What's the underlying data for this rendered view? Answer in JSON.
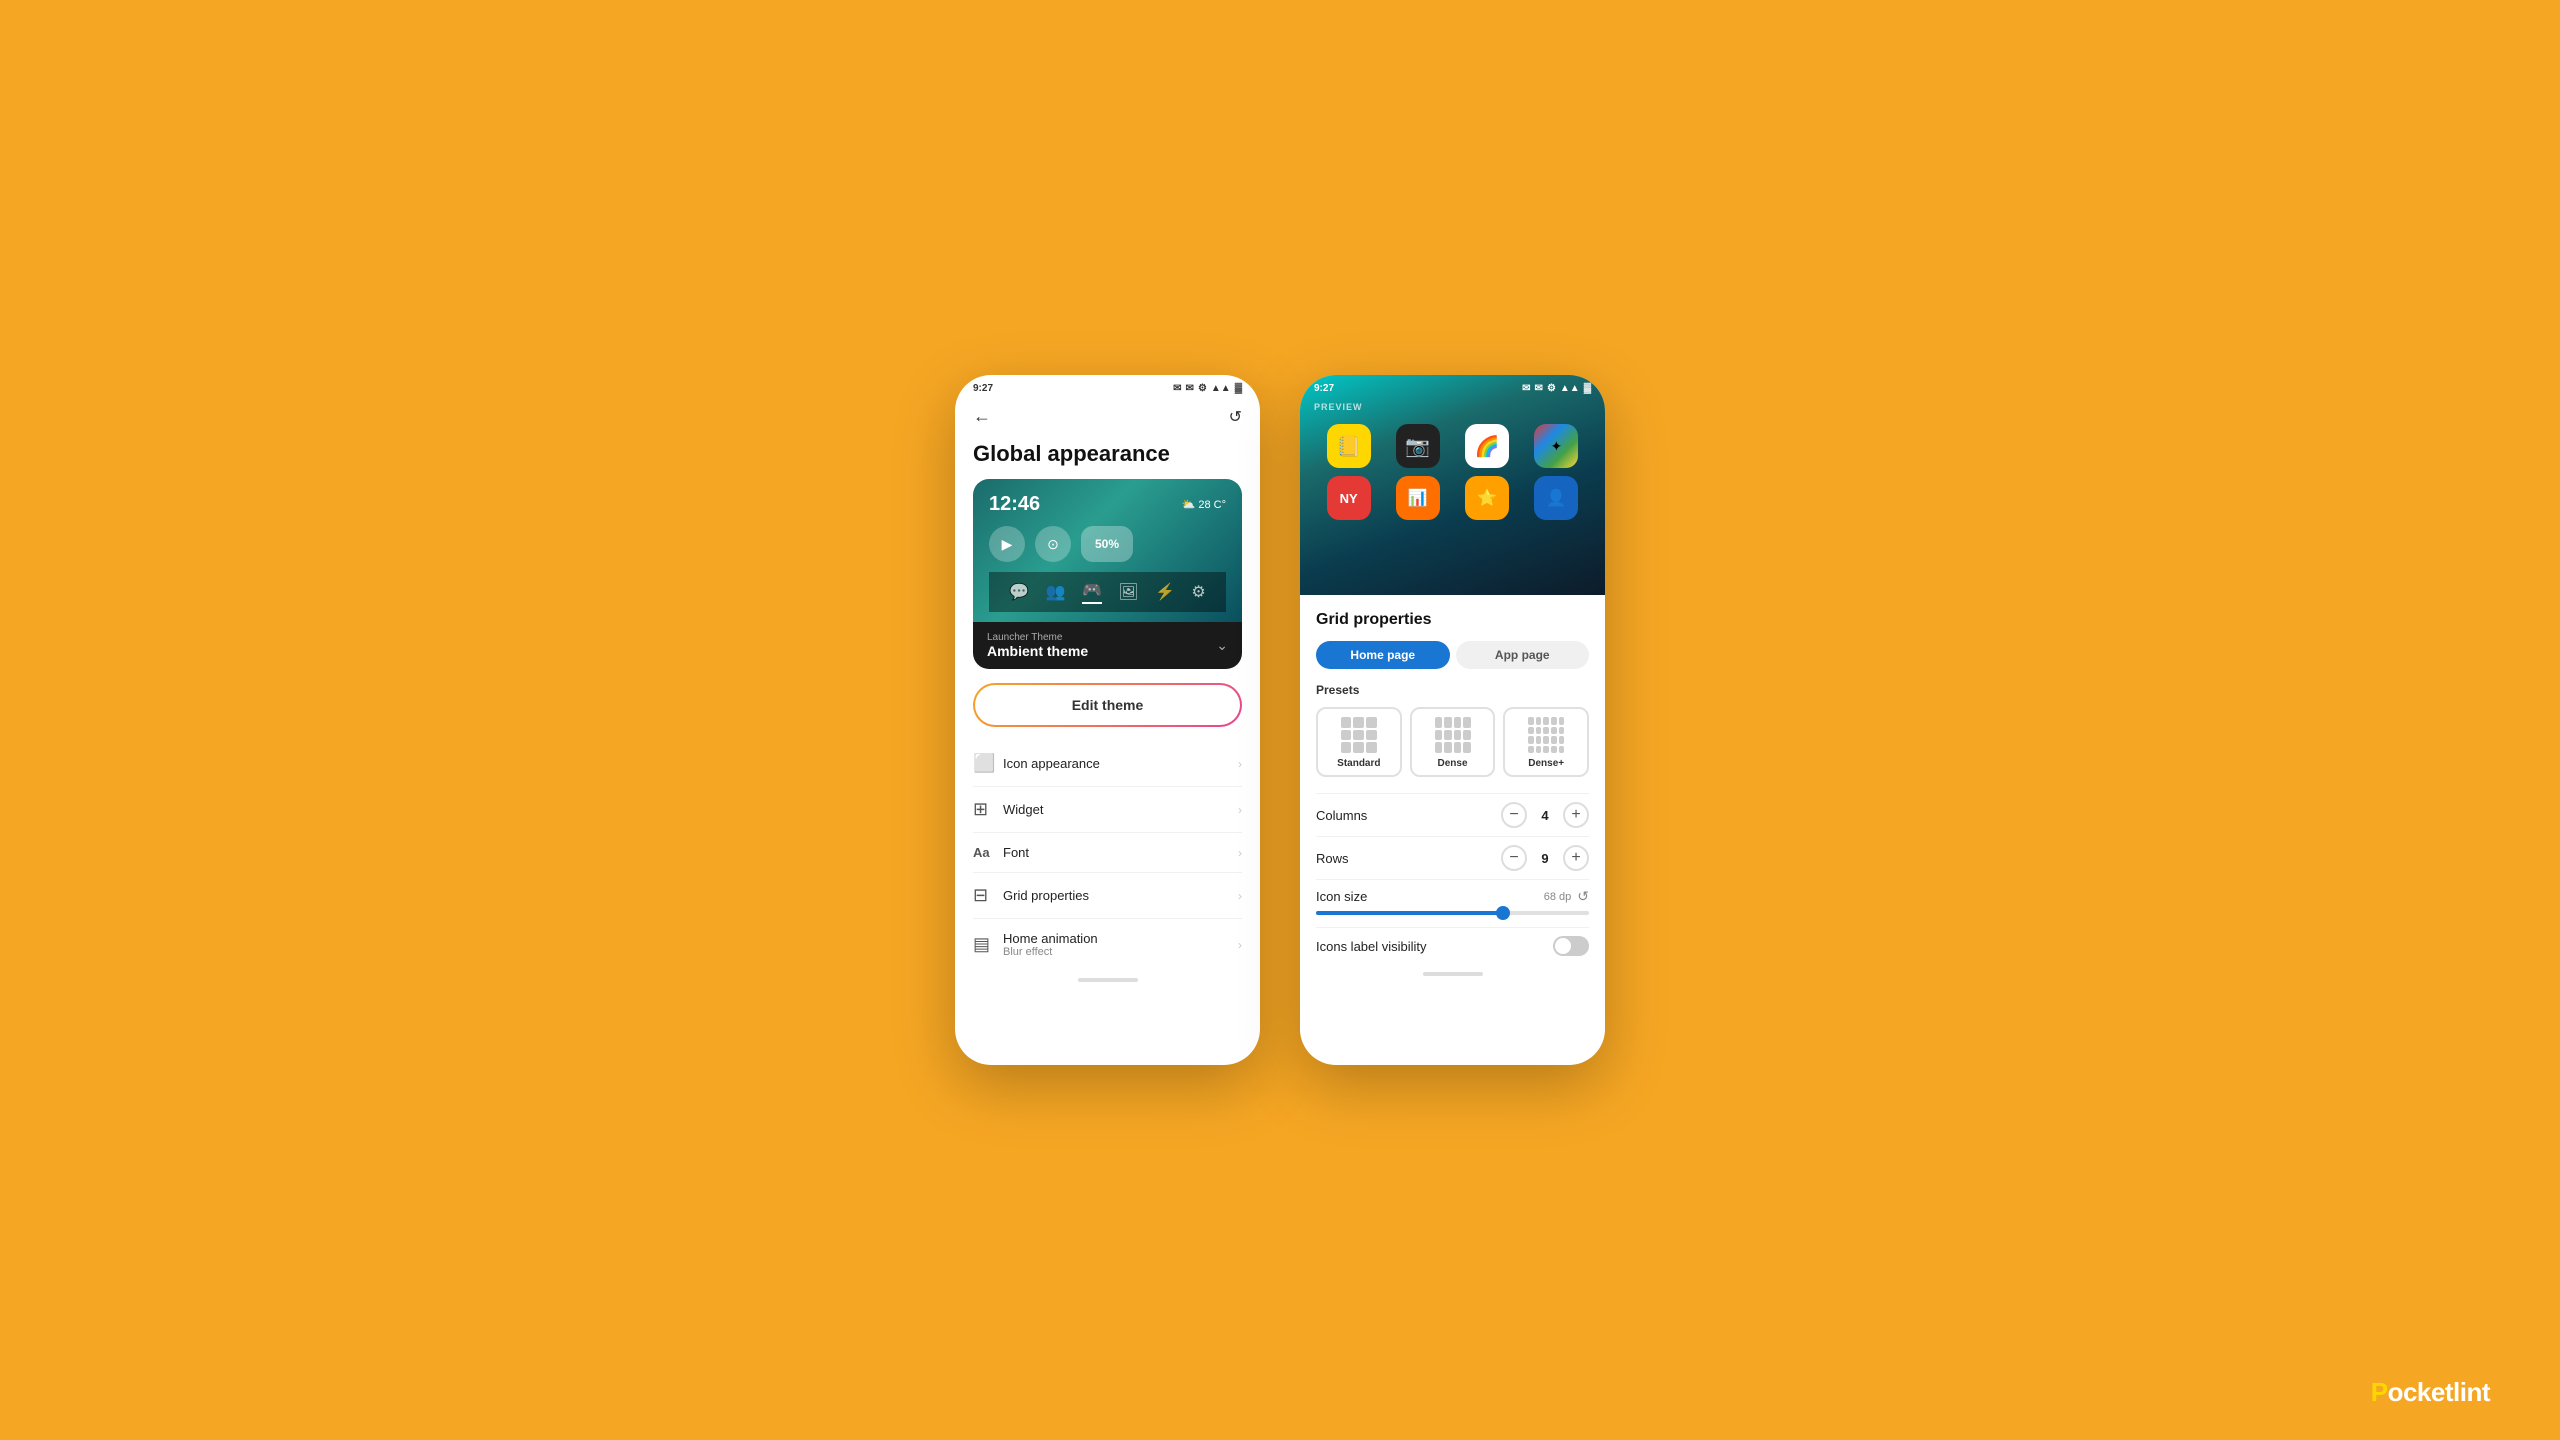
{
  "background": "#F5A623",
  "phone1": {
    "statusBar": {
      "time": "9:27",
      "icons": [
        "✉",
        "✉",
        "⚙",
        "●"
      ]
    },
    "topBar": {
      "backLabel": "←",
      "refreshLabel": "↺"
    },
    "pageTitle": "Global appearance",
    "themePreview": {
      "time": "12:46",
      "weather": "⛅ 28 C°",
      "app1": "▶",
      "app2": "⊙",
      "batteryText": "50%",
      "bottomIcons": [
        "💬",
        "👥",
        "🎮",
        "🖼",
        "🔀",
        "⚙"
      ]
    },
    "launcherSelector": {
      "label": "Launcher Theme",
      "value": "Ambient theme",
      "chevron": "⌄"
    },
    "editThemeButton": "Edit theme",
    "menuItems": [
      {
        "icon": "⬜",
        "label": "Icon appearance",
        "sublabel": "",
        "hasChevron": true
      },
      {
        "icon": "⊞",
        "label": "Widget",
        "sublabel": "",
        "hasChevron": true
      },
      {
        "icon": "Aa",
        "label": "Font",
        "sublabel": "",
        "hasChevron": true
      },
      {
        "icon": "⊟",
        "label": "Grid properties",
        "sublabel": "",
        "hasChevron": true
      },
      {
        "icon": "▤",
        "label": "Home animation",
        "sublabel": "Blur effect",
        "hasChevron": true
      }
    ]
  },
  "phone2": {
    "statusBar": {
      "time": "9:27",
      "icons": [
        "✉",
        "✉",
        "⚙",
        "●"
      ]
    },
    "previewLabel": "PREVIEW",
    "appGrid": [
      {
        "emoji": "📒",
        "bg": "yellow"
      },
      {
        "emoji": "📷",
        "bg": "dark"
      },
      {
        "emoji": "📸",
        "bg": "white"
      },
      {
        "emoji": "🎨",
        "bg": "colorful"
      },
      {
        "emoji": "📰",
        "bg": "red"
      },
      {
        "emoji": "📊",
        "bg": "orange-app"
      },
      {
        "emoji": "⭐",
        "bg": "orange-app"
      },
      {
        "emoji": "👤",
        "bg": "blue"
      }
    ],
    "gridPanel": {
      "title": "Grid properties",
      "tabs": [
        {
          "label": "Home page",
          "active": true
        },
        {
          "label": "App page",
          "active": false
        }
      ],
      "presetsLabel": "Presets",
      "presets": [
        {
          "name": "Standard",
          "type": "standard"
        },
        {
          "name": "Dense",
          "type": "dense"
        },
        {
          "name": "Dense+",
          "type": "denseplus"
        }
      ],
      "columns": {
        "label": "Columns",
        "value": "4",
        "minusBtn": "−",
        "plusBtn": "+"
      },
      "rows": {
        "label": "Rows",
        "value": "9",
        "minusBtn": "−",
        "plusBtn": "+"
      },
      "iconSize": {
        "label": "Icon size",
        "value": "68 dp",
        "resetIcon": "↺",
        "sliderPercent": 68
      },
      "iconsLabelVisibility": {
        "label": "Icons label visibility"
      }
    }
  },
  "watermark": {
    "prefix": "P",
    "highlight": "o",
    "suffix": "cketlint"
  }
}
